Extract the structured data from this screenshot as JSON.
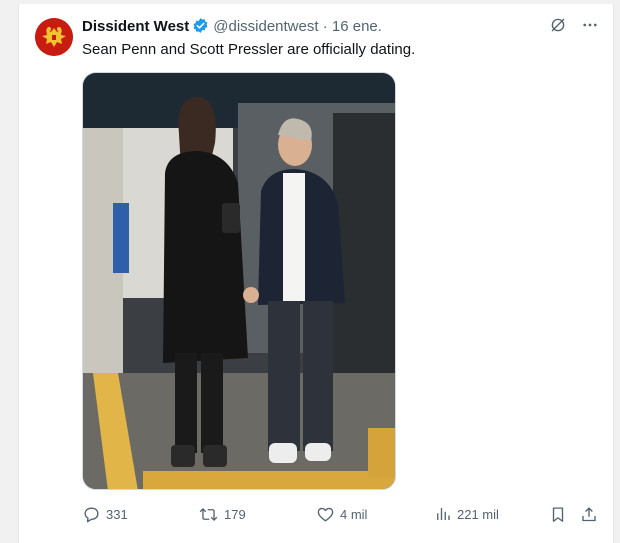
{
  "tweet": {
    "author_name": "Dissident West",
    "handle": "@dissidentwest",
    "separator": "·",
    "date": "16 ene.",
    "text": "Sean Penn and Scott Pressler are officially dating."
  },
  "actions": {
    "replies": "331",
    "retweets": "179",
    "likes": "4 mil",
    "views": "221 mil"
  },
  "colors": {
    "verified": "#1d9bf0",
    "avatar_bg": "#c81c10",
    "text": "#0f1419",
    "muted": "#536471"
  },
  "icons": [
    "verified-badge-icon",
    "grok-icon",
    "more-icon",
    "reply-icon",
    "retweet-icon",
    "like-icon",
    "views-icon",
    "bookmark-icon",
    "share-icon"
  ]
}
